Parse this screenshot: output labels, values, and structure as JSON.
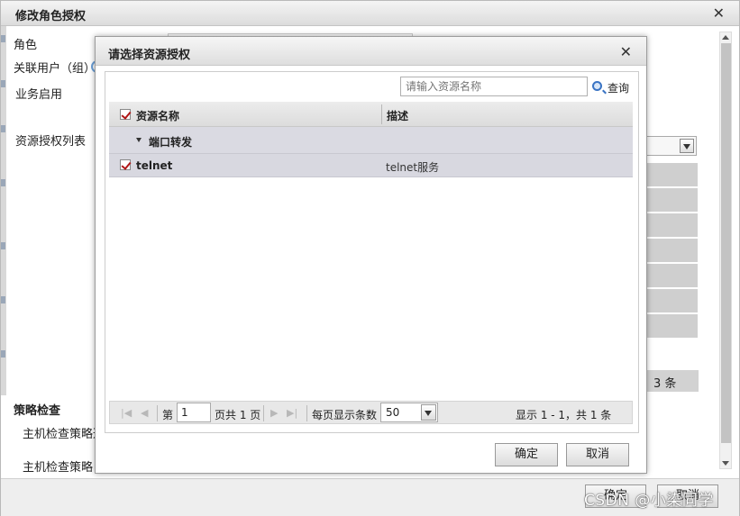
{
  "outer_dialog": {
    "title": "修改角色授权",
    "close_glyph": "✕",
    "labels": {
      "role": "角色",
      "linked_users": "关联用户（组）",
      "business_enable": "业务启用",
      "resource_list": "资源授权列表",
      "policy_check": "策略检查",
      "host_check_channel": "主机检查策略通",
      "host_check_policy": "主机检查策略"
    },
    "count_text": "3 条",
    "buttons": {
      "confirm": "确定",
      "cancel": "取消"
    }
  },
  "modal": {
    "title": "请选择资源授权",
    "close_glyph": "✕",
    "search": {
      "placeholder": "请输入资源名称",
      "button_label": "查询"
    },
    "columns": {
      "name": "资源名称",
      "description": "描述"
    },
    "group": {
      "label": "端口转发"
    },
    "rows": [
      {
        "name": "telnet",
        "description": "telnet服务",
        "checked": true
      }
    ],
    "pager": {
      "page_prefix": "第",
      "current_page": "1",
      "page_suffix": "页共 1 页",
      "page_size_label": "每页显示条数",
      "page_size": "50",
      "summary": "显示 1 - 1，共 1 条",
      "first_glyph": "|◀",
      "prev_glyph": "◀",
      "next_glyph": "▶",
      "last_glyph": "▶|"
    },
    "buttons": {
      "confirm": "确定",
      "cancel": "取消"
    }
  },
  "watermark": "CSDN @小染同学",
  "colors": {
    "check_mark": "#b01616",
    "row_bg": "#d8d8e0",
    "search_icon": "#3a74c4"
  }
}
